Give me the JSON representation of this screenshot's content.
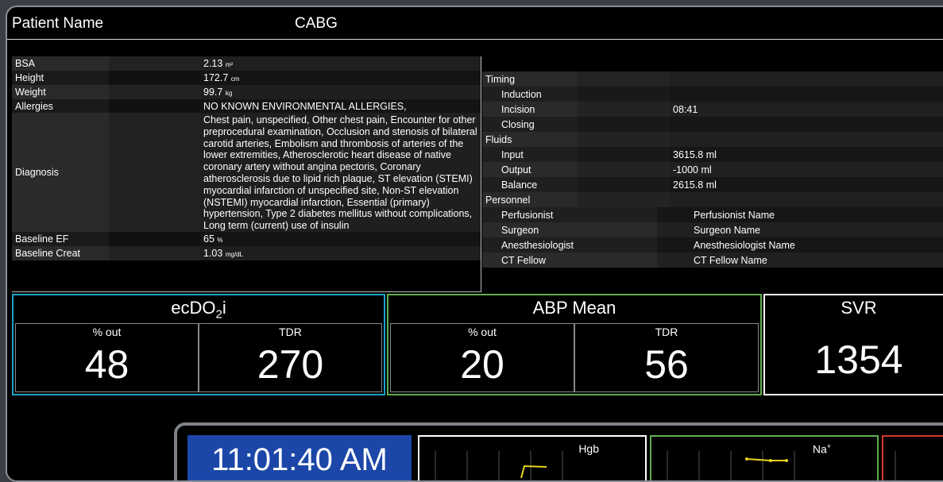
{
  "header": {
    "patient_name": "Patient Name",
    "procedure": "CABG"
  },
  "info": {
    "bsa": {
      "label": "BSA",
      "value": "2.13",
      "unit": "m²"
    },
    "height": {
      "label": "Height",
      "value": "172.7",
      "unit": "cm"
    },
    "weight": {
      "label": "Weight",
      "value": "99.7",
      "unit": "kg"
    },
    "allergies": {
      "label": "Allergies",
      "value": "NO KNOWN ENVIRONMENTAL ALLERGIES,"
    },
    "diagnosis": {
      "label": "Diagnosis",
      "value": "Chest pain, unspecified, Other chest pain, Encounter for other preprocedural examination, Occlusion and stenosis of bilateral carotid arteries, Embolism and thrombosis of arteries of the lower extremities, Atherosclerotic heart disease of native coronary artery without angina pectoris, Coronary atherosclerosis due to lipid rich plaque, ST elevation (STEMI) myocardial infarction of unspecified site, Non-ST elevation (NSTEMI) myocardial infarction, Essential (primary) hypertension, Type 2 diabetes mellitus without complications, Long term (current) use of insulin"
    },
    "baseline_ef": {
      "label": "Baseline EF",
      "value": "65",
      "unit": "%"
    },
    "baseline_creat": {
      "label": "Baseline Creat",
      "value": "1.03",
      "unit": "mg/dL"
    }
  },
  "timing": {
    "label": "Timing",
    "induction": {
      "label": "Induction",
      "value": ""
    },
    "incision": {
      "label": "Incision",
      "value": "08:41"
    },
    "closing": {
      "label": "Closing",
      "value": ""
    }
  },
  "fluids": {
    "label": "Fluids",
    "input": {
      "label": "Input",
      "value": "3615.8 ml"
    },
    "output": {
      "label": "Output",
      "value": "-1000 ml"
    },
    "balance": {
      "label": "Balance",
      "value": "2615.8 ml"
    }
  },
  "personnel": {
    "label": "Personnel",
    "perfusionist": {
      "label": "Perfusionist",
      "value": "Perfusionist Name"
    },
    "surgeon": {
      "label": "Surgeon",
      "value": "Surgeon Name"
    },
    "anesthesiologist": {
      "label": "Anesthesiologist",
      "value": "Anesthesiologist Name"
    },
    "ct_fellow": {
      "label": "CT Fellow",
      "value": "CT Fellow Name"
    }
  },
  "metrics": {
    "ecdo2i": {
      "title_main": "ecDO",
      "title_sub": "2",
      "title_tail": "i",
      "color": "#1aa3c8",
      "pct_label": "% out",
      "pct_value": "48",
      "tdr_label": "TDR",
      "tdr_value": "270"
    },
    "abp": {
      "title": "ABP Mean",
      "color": "#5fae4b",
      "pct_label": "% out",
      "pct_value": "20",
      "tdr_label": "TDR",
      "tdr_value": "56"
    },
    "svr": {
      "title": "SVR",
      "color": "#ffffff",
      "value": "1354"
    }
  },
  "lower": {
    "clock": "11:01:40 AM",
    "hgb": {
      "label": "Hgb",
      "color": "#ffffff",
      "line_color": "#e8d21a"
    },
    "na": {
      "label": "Na",
      "sup": "+",
      "color": "#5fae4b",
      "line_color": "#e8d21a"
    },
    "third": {
      "color": "#d23a2a"
    }
  }
}
